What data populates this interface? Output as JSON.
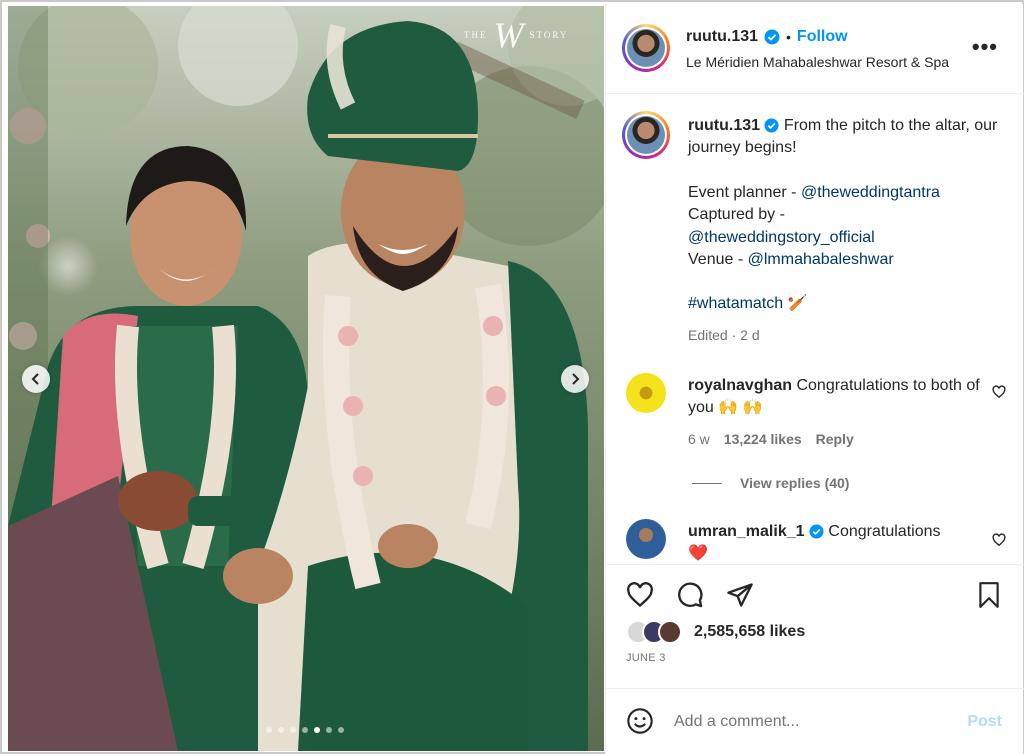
{
  "photo": {
    "watermark_left": "THE",
    "watermark_logo": "W",
    "watermark_right": "STORY",
    "carousel_dots": 7,
    "active_dot": 5
  },
  "header": {
    "username": "ruutu.131",
    "separator": "•",
    "follow_label": "Follow",
    "location": "Le Méridien Mahabaleshwar Resort & Spa",
    "more_label": "•••"
  },
  "caption": {
    "username": "ruutu.131",
    "text_line1": " From the pitch to the altar, our journey begins!",
    "event_label": "Event planner - ",
    "event_handle": "@theweddingtantra",
    "captured_label": "Captured by - ",
    "captured_handle": "@theweddingstory_official",
    "venue_label": "Venue - ",
    "venue_handle": "@lmmahabaleshwar",
    "hashtag": "#whatamatch",
    "hashtag_emoji": "🏏",
    "edited": "Edited · 2 d"
  },
  "comments": [
    {
      "username": "royalnavghan",
      "text": " Congratulations to both of you 🙌 🙌",
      "age": "6 w",
      "likes": "13,224 likes",
      "reply": "Reply",
      "view_replies": "View replies (40)"
    },
    {
      "username": "umran_malik_1",
      "text": " Congratulations",
      "emoji": "❤️"
    }
  ],
  "actions": {
    "likes": "2,585,658 likes",
    "date": "JUNE 3"
  },
  "add_comment": {
    "placeholder": "Add a comment...",
    "post_label": "Post"
  },
  "colors": {
    "link": "#00376b",
    "follow": "#0095f6",
    "verified": "#0095f6",
    "muted": "#737373",
    "post_disabled": "#b3dbff"
  }
}
